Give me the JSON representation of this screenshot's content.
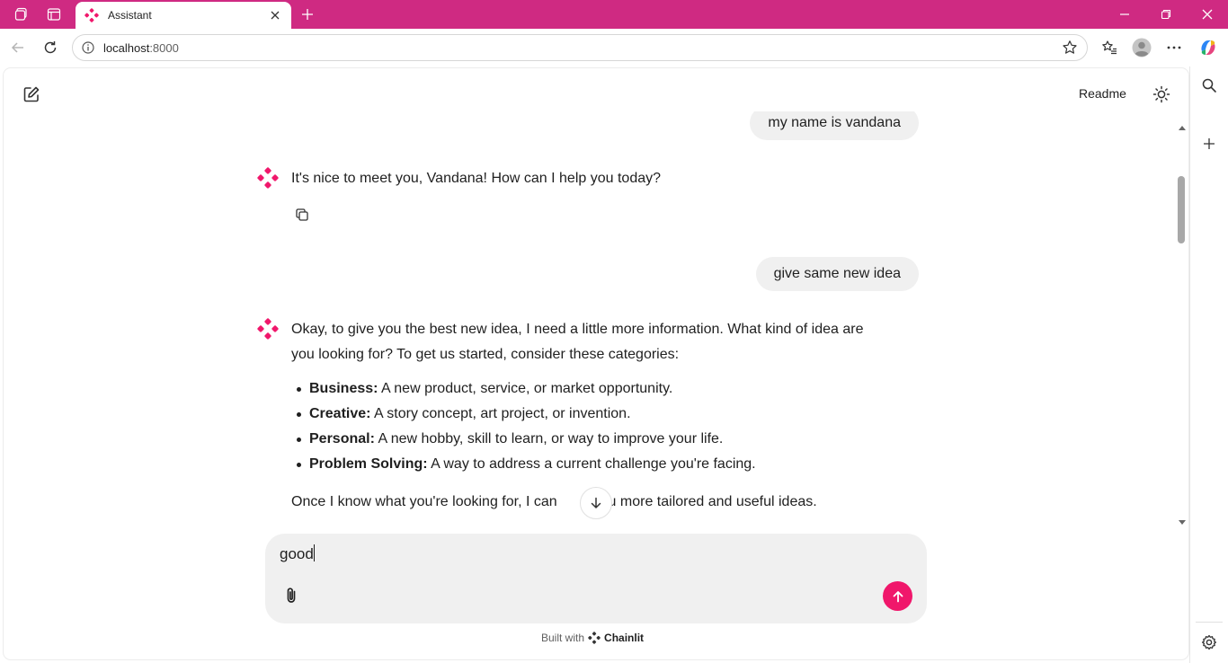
{
  "browser": {
    "tab_title": "Assistant",
    "url_host": "localhost",
    "url_port": ":8000"
  },
  "header": {
    "readme_label": "Readme"
  },
  "chat": {
    "user_messages": [
      "my name is vandana",
      "give same new idea"
    ],
    "bot_reply_1": "It's nice to meet you, Vandana! How can I help you today?",
    "bot_reply_2_intro_line1": "Okay, to give you the best new idea, I need a little more information. What kind of idea are",
    "bot_reply_2_intro_line2": "you looking for?  To get us started, consider these categories:",
    "categories": [
      {
        "name": "Business:",
        "desc": " A new product, service, or market opportunity."
      },
      {
        "name": "Creative:",
        "desc": " A story concept, art project, or invention."
      },
      {
        "name": "Personal:",
        "desc": " A new hobby, skill to learn, or way to improve your life."
      },
      {
        "name": "Problem Solving:",
        "desc": " A way to address a current challenge you're facing."
      }
    ],
    "closing_before": "Once I know what you're looking for, I can",
    "closing_after": "you more tailored and useful ideas."
  },
  "composer": {
    "value": "good"
  },
  "footer": {
    "built_with": "Built with",
    "brand": "Chainlit"
  },
  "colors": {
    "titlebar": "#cf2a82",
    "accent": "#f0176b",
    "bubble": "#f0f0f0"
  }
}
